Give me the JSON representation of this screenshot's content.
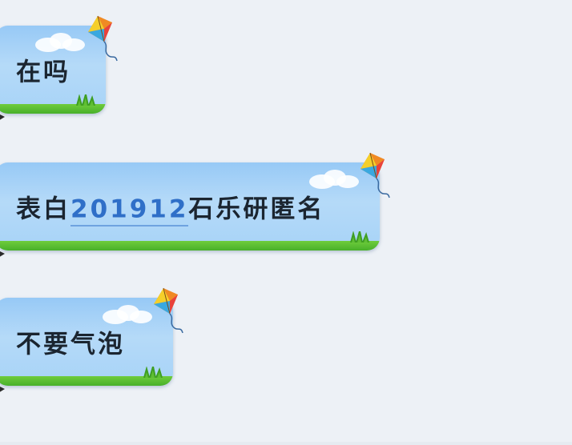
{
  "conversation": {
    "messages": [
      {
        "text": "在吗"
      },
      {
        "prefix": "表白",
        "link": "201912",
        "suffix": "石乐研匿名"
      },
      {
        "text": "不要气泡"
      }
    ]
  },
  "theme": {
    "background": "#edf1f6",
    "bubble_blue": "#a7d3f7",
    "grass_green": "#48b02a",
    "link_blue": "#2f6fc8"
  },
  "icons": [
    "kite-icon",
    "cloud-icon",
    "grass-icon"
  ]
}
